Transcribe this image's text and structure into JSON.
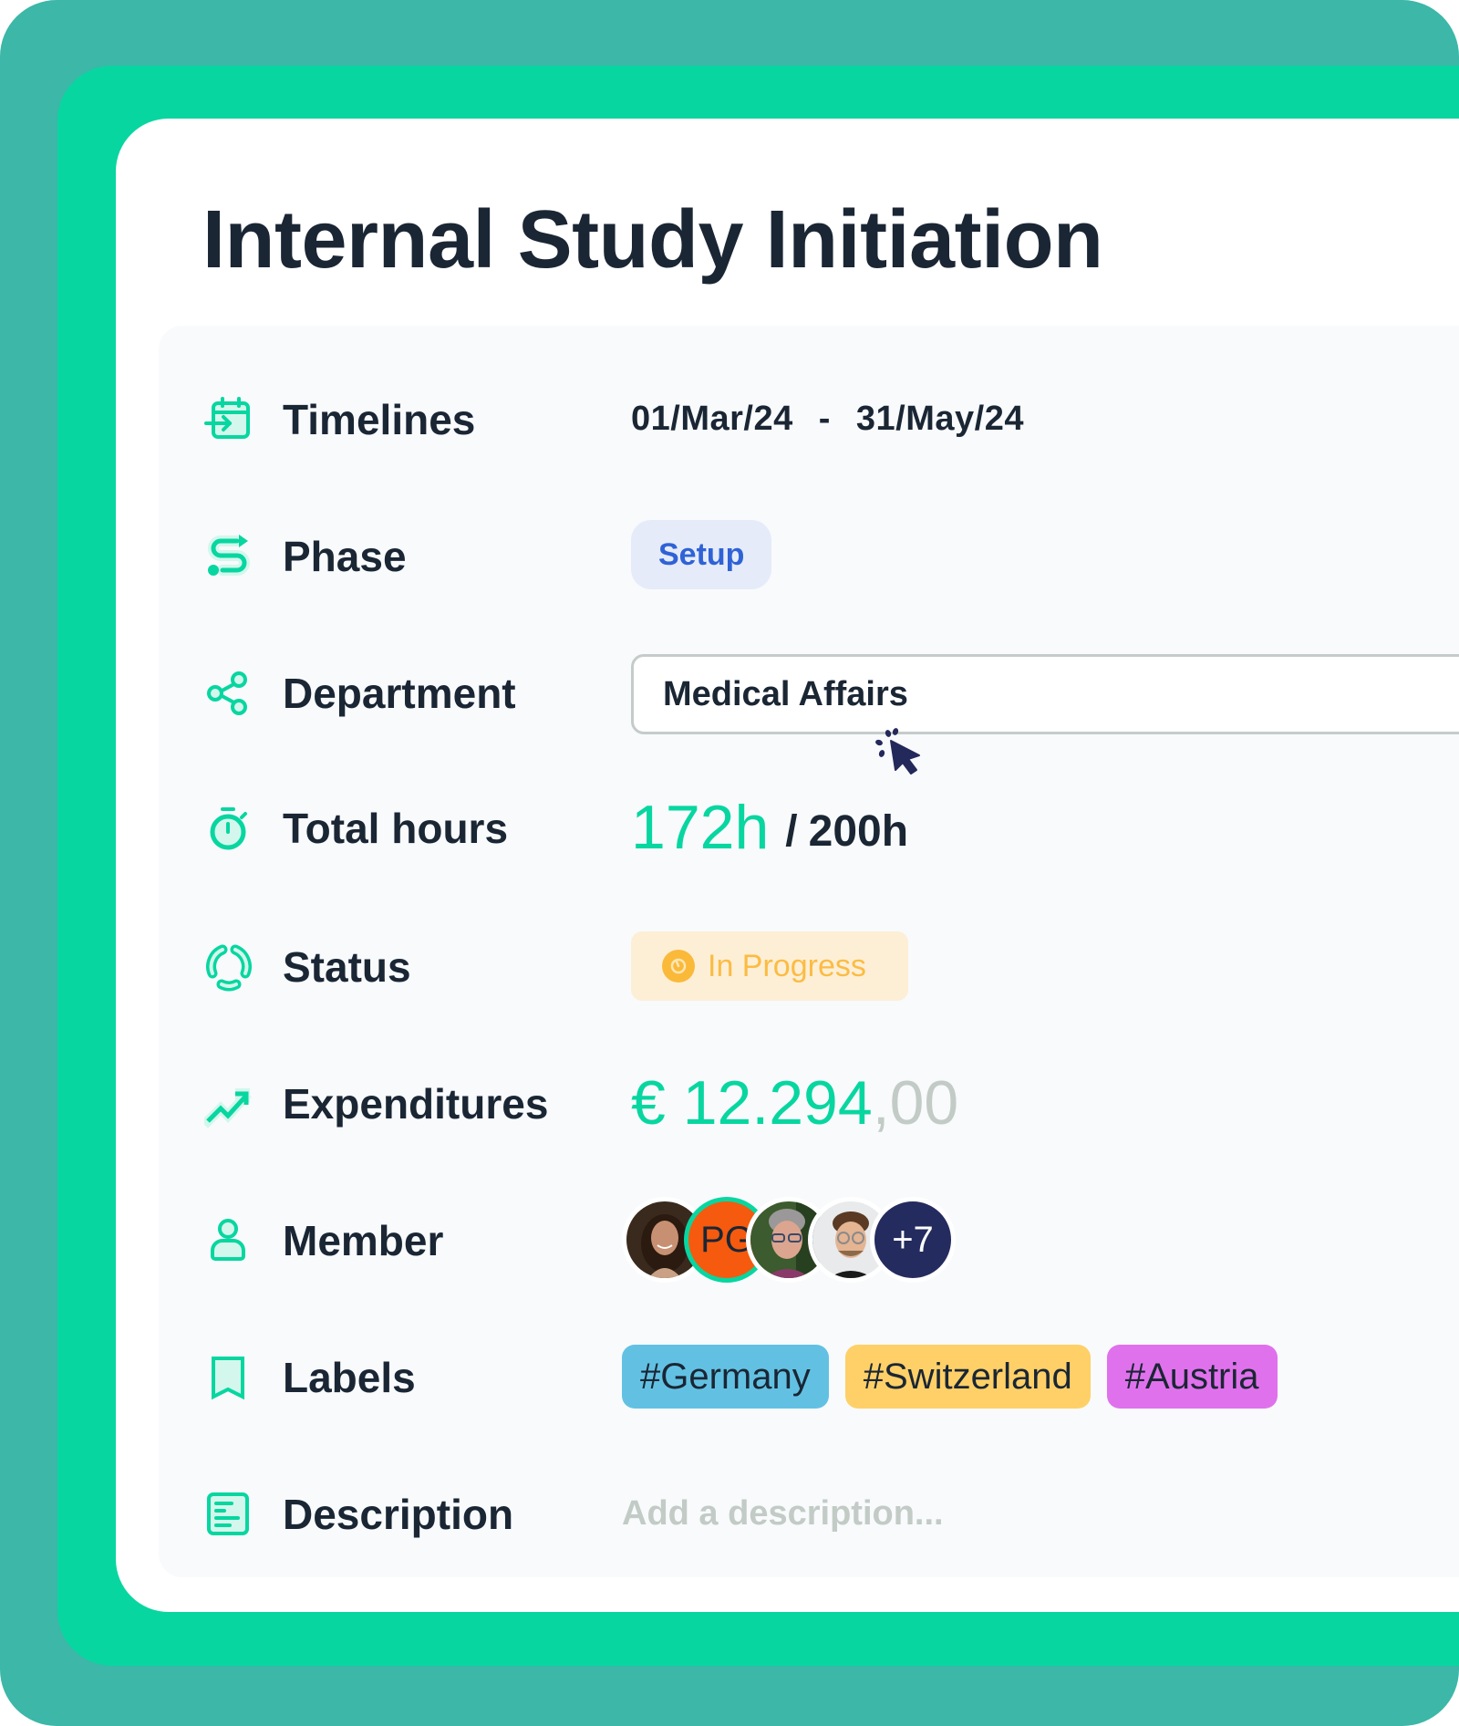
{
  "title": "Internal Study Initiation",
  "colors": {
    "frame_outer": "#3cb7a8",
    "frame_accent": "#08d6a0",
    "text_primary": "#1a2634",
    "muted": "#c2cbc6"
  },
  "fields": {
    "timelines": {
      "label": "Timelines",
      "icon": "calendar-arrow-icon",
      "start": "01/Mar/24",
      "separator": "-",
      "end": "31/May/24"
    },
    "phase": {
      "label": "Phase",
      "icon": "route-icon",
      "value": "Setup"
    },
    "department": {
      "label": "Department",
      "icon": "share-icon",
      "value": "Medical Affairs"
    },
    "total_hours": {
      "label": "Total hours",
      "icon": "stopwatch-icon",
      "current": "172h",
      "separator": "/",
      "total": "200h"
    },
    "status": {
      "label": "Status",
      "icon": "status-cycle-icon",
      "value": "In Progress",
      "color": "#fbbc44"
    },
    "expenditures": {
      "label": "Expenditures",
      "icon": "trending-up-icon",
      "amount_main": "€ 12.294",
      "amount_decimals": ",00"
    },
    "member": {
      "label": "Member",
      "icon": "user-icon",
      "avatars": [
        {
          "type": "photo",
          "name": "member-1"
        },
        {
          "type": "initials",
          "initials": "PG"
        },
        {
          "type": "photo",
          "name": "member-3"
        },
        {
          "type": "photo",
          "name": "member-4"
        }
      ],
      "more_count": "+7"
    },
    "labels": {
      "label": "Labels",
      "icon": "bookmark-icon",
      "tags": [
        {
          "text": "#Germany",
          "color": "#62c1e3"
        },
        {
          "text": "#Switzerland",
          "color": "#fed067"
        },
        {
          "text": "#Austria",
          "color": "#e071ec"
        }
      ]
    },
    "description": {
      "label": "Description",
      "icon": "document-icon",
      "placeholder": "Add a description..."
    }
  }
}
